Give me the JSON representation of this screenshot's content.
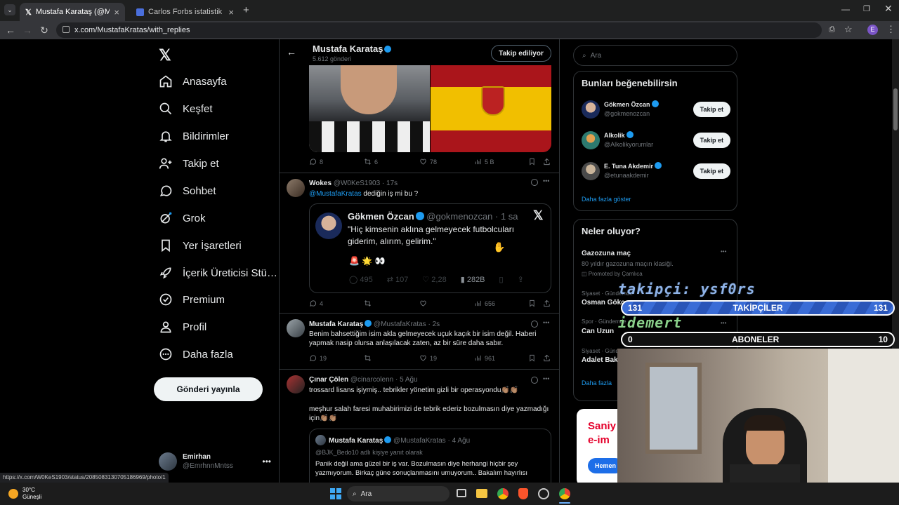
{
  "browser": {
    "tabs": [
      {
        "title": "Mustafa Karataş (@MustafaKra…",
        "active": true
      },
      {
        "title": "Carlos Forbs istatistikleri ve rey…",
        "active": false
      }
    ],
    "url": "x.com/MustafaKratas/with_replies",
    "status_url": "https://x.com/W0KeS1903/status/2085083130705186969/photo/1",
    "profile_letter": "E"
  },
  "sidebar": {
    "items": [
      {
        "label": "Anasayfa",
        "icon": "home-icon"
      },
      {
        "label": "Keşfet",
        "icon": "search-icon"
      },
      {
        "label": "Bildirimler",
        "icon": "bell-icon"
      },
      {
        "label": "Takip et",
        "icon": "follow-icon"
      },
      {
        "label": "Sohbet",
        "icon": "chat-icon"
      },
      {
        "label": "Grok",
        "icon": "grok-icon"
      },
      {
        "label": "Yer İşaretleri",
        "icon": "bookmark-icon"
      },
      {
        "label": "İçerik Üreticisi Stü…",
        "icon": "rocket-icon"
      },
      {
        "label": "Premium",
        "icon": "premium-icon"
      },
      {
        "label": "Profil",
        "icon": "person-icon"
      },
      {
        "label": "Daha fazla",
        "icon": "more-icon"
      }
    ],
    "post_button": "Gönderi yayınla",
    "user": {
      "name": "Emirhan",
      "handle": "@EmrhnnMntss"
    }
  },
  "header": {
    "name": "Mustafa Karataş",
    "post_count": "5.612 gönderi",
    "follow_state": "Takip ediliyor"
  },
  "tweet0_actions": {
    "reply": "8",
    "retweet": "6",
    "like": "78",
    "views": "5 B"
  },
  "tweet1": {
    "name": "Wokes",
    "handle": "@W0KeS1903",
    "time": "17s",
    "mention": "@MustafaKratas",
    "text": " dediğin iş mi bu ?",
    "quote": {
      "name": "Gökmen Özcan",
      "handle": "@gokmenozcan",
      "time": "1 sa",
      "text": "\"Hiç kimsenin aklına gelmeyecek futbolcuları giderim, alırım, gelirim.\"",
      "emojis": "🚨 🌟 👀",
      "reply": "495",
      "retweet": "107",
      "like": "2,28",
      "views": "282B"
    },
    "actions": {
      "reply": "4",
      "retweet": "",
      "like": "",
      "views": "656"
    }
  },
  "tweet2": {
    "name": "Mustafa Karataş",
    "handle": "@MustafaKratas",
    "time": "2s",
    "text": "Benim bahsettiğim isim akla gelmeyecek uçuk kaçık bir isim değil. Haberi yapmak nasip olursa anlaşılacak zaten, az bir süre daha sabır.",
    "actions": {
      "reply": "19",
      "retweet": "",
      "like": "19",
      "views": "961"
    }
  },
  "tweet3": {
    "name": "Çınar Çölen",
    "handle": "@cinarcolenn",
    "time": "5 Ağu",
    "text1": "trossard lisans işiymiş.. tebrikler yönetim gizli bir operasyondu👏🏽👏🏽",
    "text2": "meşhur salah faresi muhabirimizi de tebrik ederiz bozulmasın diye yazmadığı için👏🏽👏🏽",
    "quote": {
      "name": "Mustafa Karataş",
      "handle": "@MustafaKratas",
      "time": "4 Ağu",
      "reply_to": "@BJK_Bedo10 adlı kişiye yanıt olarak",
      "text": "Panik değil ama güzel bir iş var. Bozulmasın diye herhangi hiçbir şey yazmıyorum. Birkaç güne sonuçlanmasını umuyorum.. Bakalım hayırlısı"
    }
  },
  "right": {
    "search_placeholder": "Ara",
    "suggestions_title": "Bunları beğenebilirsin",
    "suggestions": [
      {
        "name": "Gökmen Özcan",
        "handle": "@gokmenozcan",
        "button": "Takip et"
      },
      {
        "name": "Alkolik",
        "handle": "@Alkolikyorumlar",
        "button": "Takip et"
      },
      {
        "name": "E. Tuna Akdemir",
        "handle": "@etunaakdemir",
        "button": "Takip et"
      }
    ],
    "show_more": "Daha fazla göster",
    "trends_title": "Neler oluyor?",
    "trends": [
      {
        "title": "Gazozuna maç",
        "sub": "80 yıldır gazozuna maçın klasiği.",
        "promo": "Promoted by Çamlıca"
      },
      {
        "meta": "Siyaset · Gündemde",
        "title": "Osman Gökçe"
      },
      {
        "meta": "Spor · Gündemde",
        "title": "Can Uzun"
      },
      {
        "meta": "Siyaset · Gündemde",
        "title": "Adalet Bak"
      }
    ],
    "trends_more": "Daha fazla",
    "ad_text1": "Saniy",
    "ad_text2": "e-im",
    "ad_button": "Hemen"
  },
  "overlay": {
    "follower_text": "takipçi: ysf0rs",
    "followers_label": "TAKİPÇİLER",
    "followers_left": "131",
    "followers_right": "131",
    "sub_text": "idemert",
    "subs_label": "ABONELER",
    "subs_left": "0",
    "subs_right": "10"
  },
  "taskbar": {
    "temp": "30°C",
    "weather": "Güneşli",
    "search": "Ara"
  }
}
